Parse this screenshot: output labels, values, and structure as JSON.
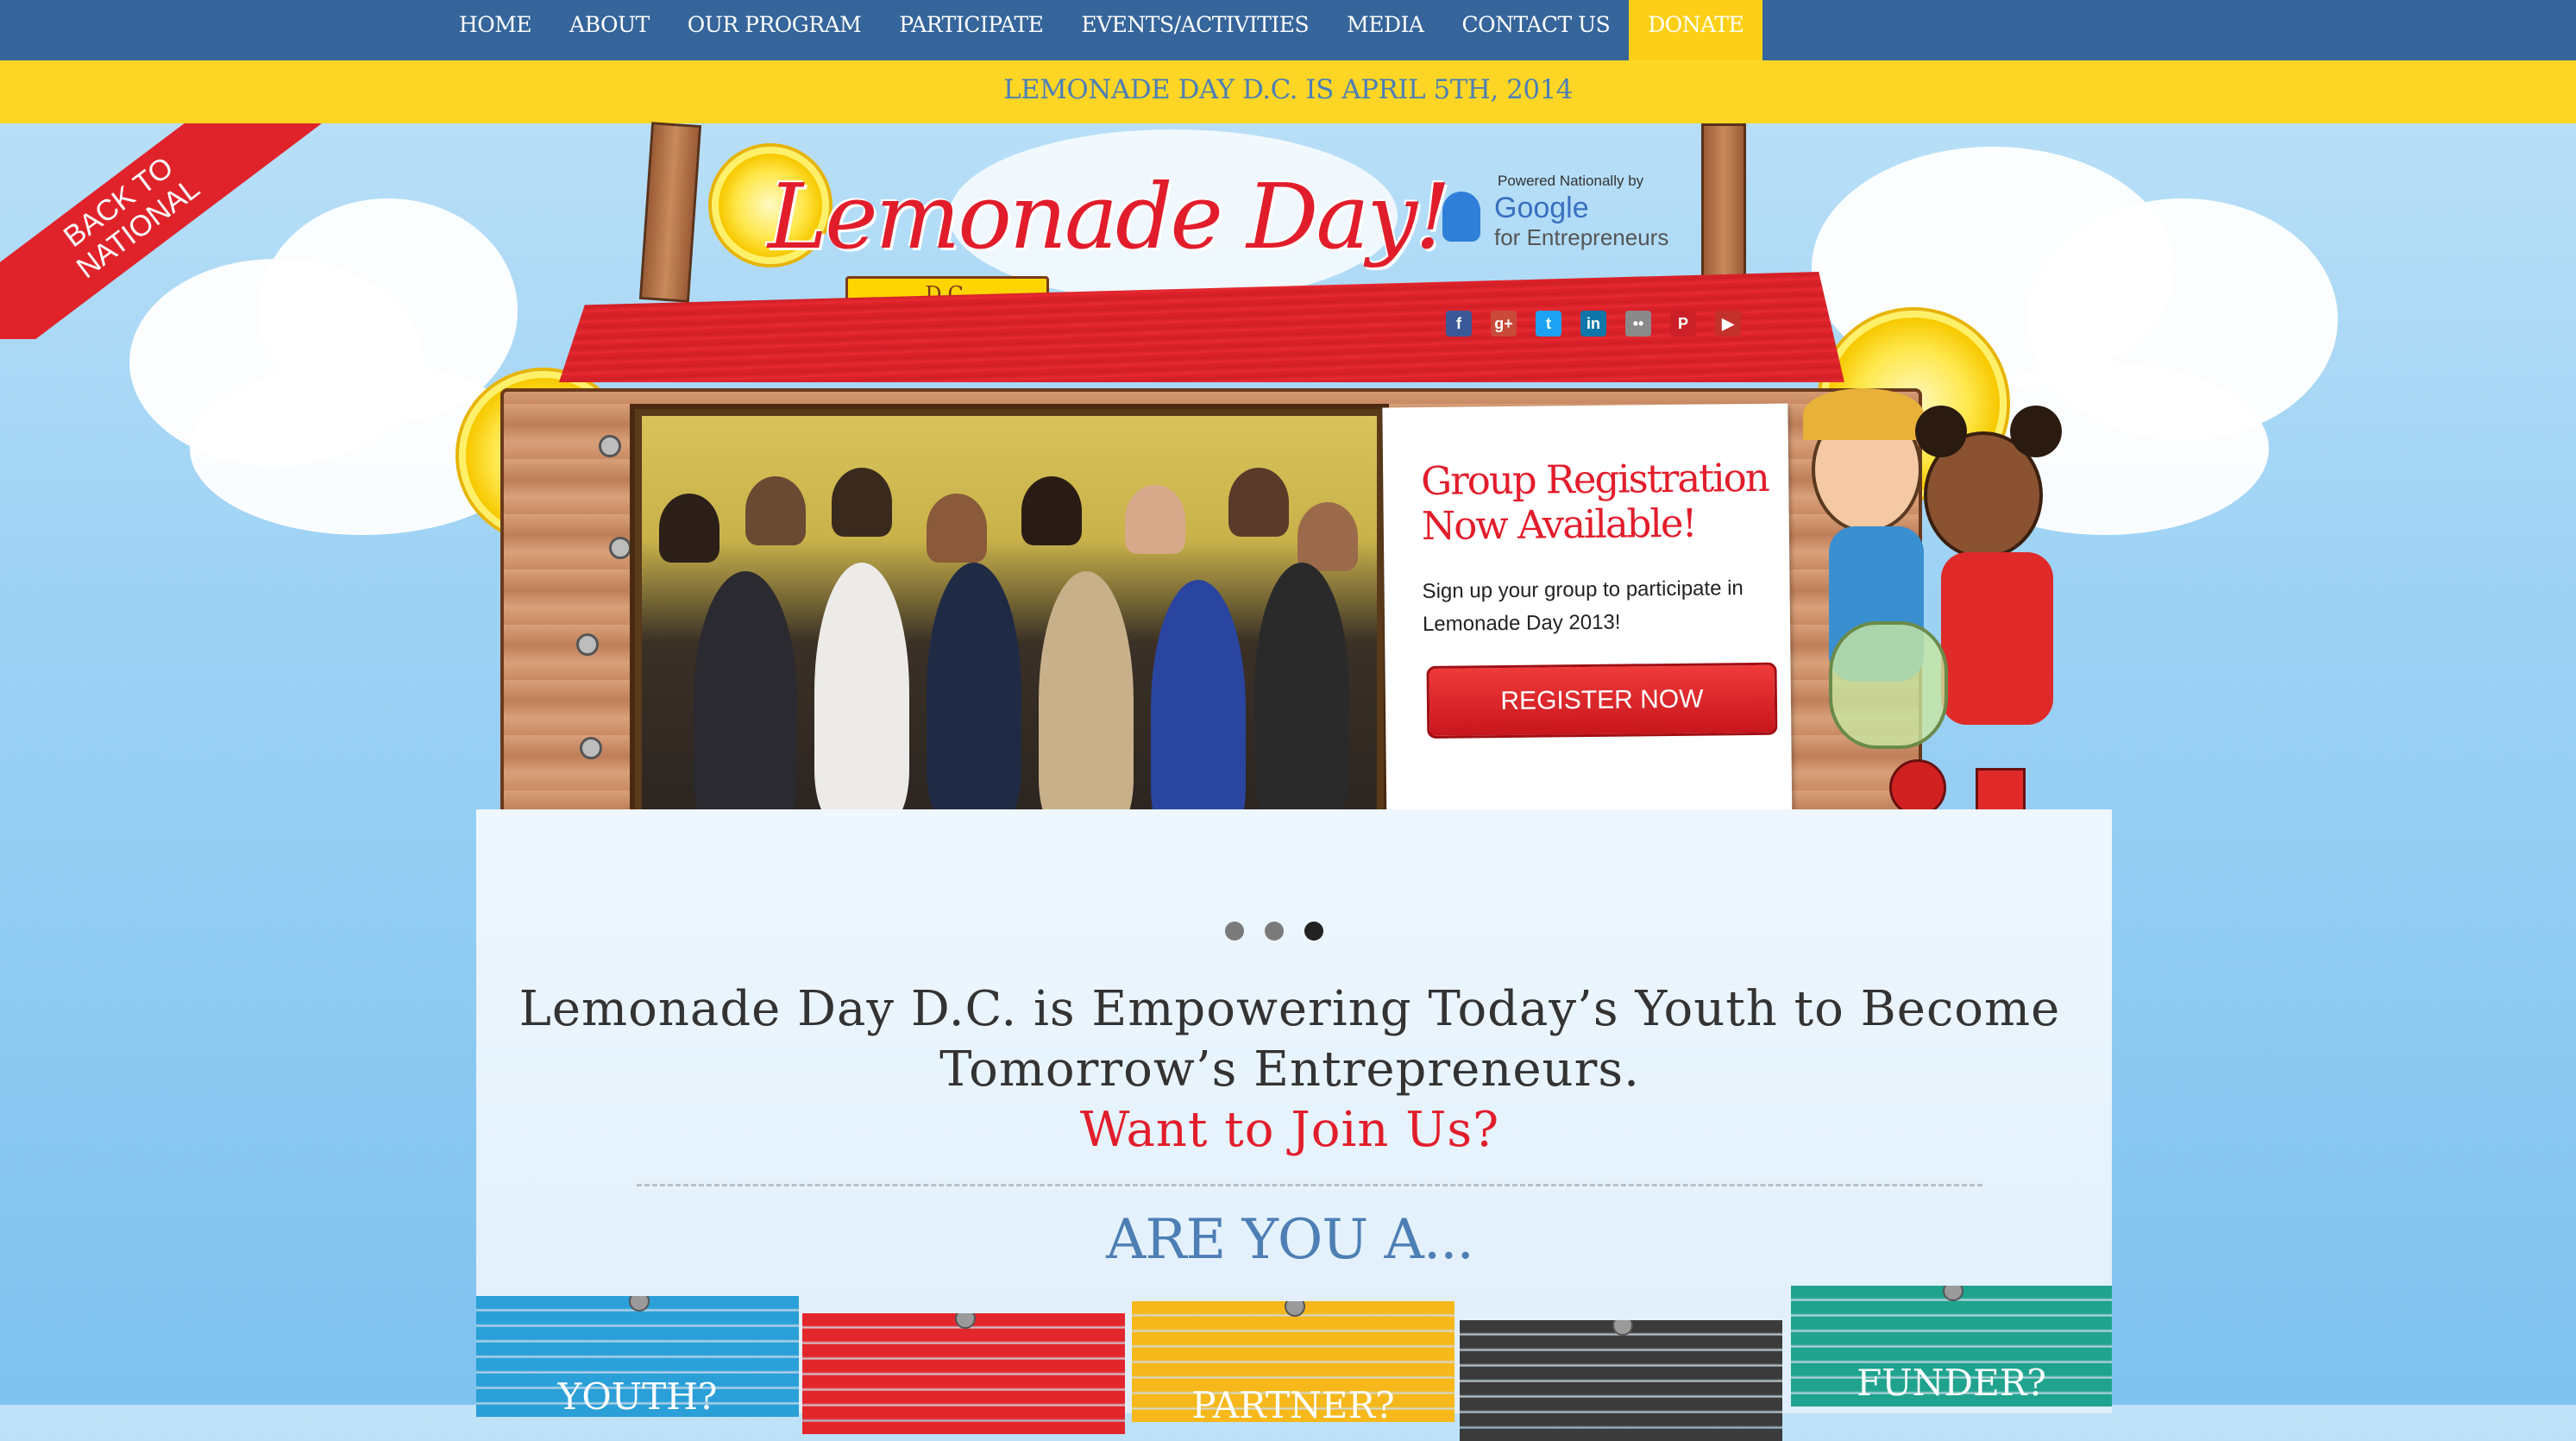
{
  "nav": {
    "items": [
      "HOME",
      "ABOUT",
      "OUR PROGRAM",
      "PARTICIPATE",
      "EVENTS/ACTIVITIES",
      "MEDIA",
      "CONTACT US"
    ],
    "donate": "DONATE"
  },
  "banner": "LEMONADE DAY D.C.  IS APRIL 5TH, 2014",
  "ribbon": {
    "line1": "BACK TO",
    "line2": "NATIONAL"
  },
  "logo": {
    "title": "Lemonade Day!",
    "sub": "D.C."
  },
  "google": {
    "powered": "Powered Nationally by",
    "brand": "Google",
    "tag": "for Entrepreneurs"
  },
  "social": [
    {
      "icon": "facebook-icon",
      "glyph": "f",
      "color": "#3b5998"
    },
    {
      "icon": "google-plus-icon",
      "glyph": "g+",
      "color": "#c94a38"
    },
    {
      "icon": "twitter-icon",
      "glyph": "t",
      "color": "#1da1f2"
    },
    {
      "icon": "linkedin-icon",
      "glyph": "in",
      "color": "#0e76a8"
    },
    {
      "icon": "flickr-icon",
      "glyph": "••",
      "color": "#8a8a8a"
    },
    {
      "icon": "pinterest-icon",
      "glyph": "P",
      "color": "#cb2027"
    },
    {
      "icon": "youtube-icon",
      "glyph": "▶",
      "color": "#c4302b"
    }
  ],
  "slide": {
    "heading_line1": "Group Registration",
    "heading_line2": "Now Available!",
    "text": "Sign up your group to participate in Lemonade Day 2013!",
    "button": "REGISTER NOW"
  },
  "tagline": {
    "line": "Lemonade Day D.C. is Empowering Today’s Youth to Become Tomorrow’s Entrepreneurs.",
    "cta": "Want to Join Us?"
  },
  "are_you": "ARE YOU A...",
  "signs": [
    {
      "label": "YOUTH?",
      "color": "#2a9fd8"
    },
    {
      "label": "",
      "color": "#e3262c"
    },
    {
      "label": "PARTNER?",
      "color": "#f6b81a"
    },
    {
      "label": "",
      "color": "#3b3b3b"
    },
    {
      "label": "FUNDER?",
      "color": "#1fa38f"
    }
  ],
  "colors": {
    "nav": "#35659b",
    "banner": "#fdd625",
    "donate": "#fdd017",
    "accent_red": "#e21d2b",
    "accent_blue": "#4d7fb5"
  }
}
